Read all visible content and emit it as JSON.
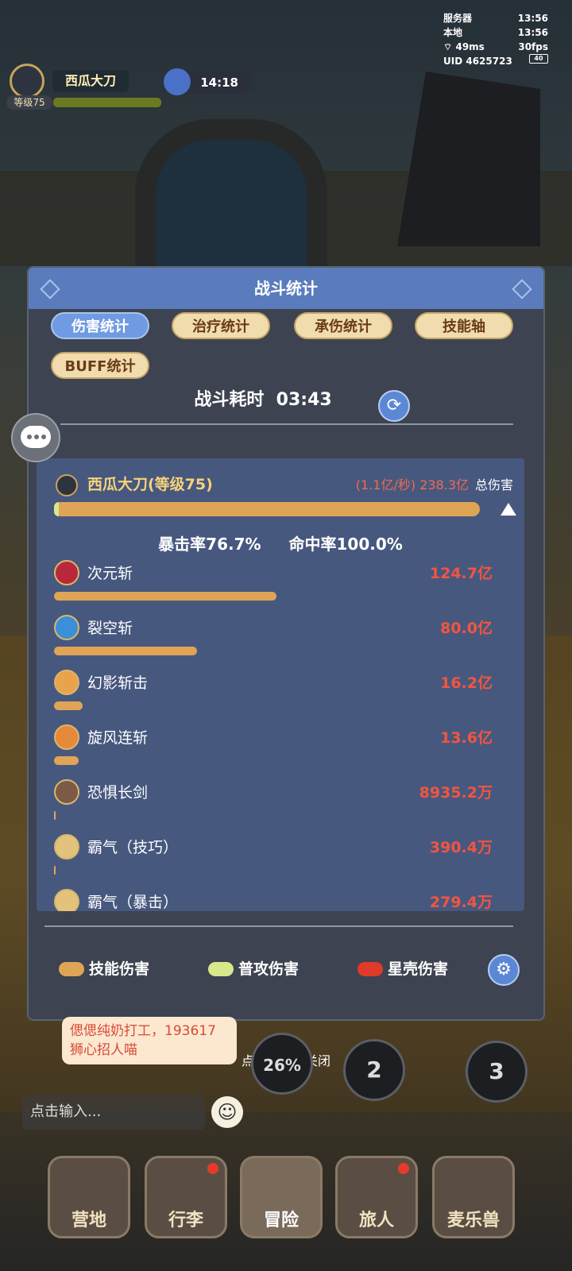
{
  "status": {
    "server_label": "服务器",
    "server_time": "13:56",
    "local_label": "本地",
    "local_time": "13:56",
    "ping": "49ms",
    "fps": "30fps",
    "uid": "UID 4625723",
    "battery": "40"
  },
  "player": {
    "name": "西瓜大刀",
    "level_badge": "等级75",
    "timer": "14:18"
  },
  "dialog": {
    "title": "战斗统计",
    "tabs": [
      "伤害统计",
      "治疗统计",
      "承伤统计",
      "技能轴",
      "BUFF统计"
    ],
    "active_tab": "伤害统计",
    "duration_label": "战斗耗时",
    "duration": "03:43",
    "character": {
      "name": "西瓜大刀(等级75)",
      "rate": "(1.1亿/秒)",
      "total": "238.3亿",
      "total_label": "总伤害",
      "crit": "暴击率76.7%",
      "hit": "命中率100.0%"
    },
    "skills": [
      {
        "name": "次元斩",
        "value": "124.7亿",
        "share": 0.523,
        "icon": "slash-red-icon"
      },
      {
        "name": "裂空斩",
        "value": "80.0亿",
        "share": 0.336,
        "icon": "rift-blue-icon"
      },
      {
        "name": "幻影斩击",
        "value": "16.2亿",
        "share": 0.068,
        "icon": "phantom-icon"
      },
      {
        "name": "旋风连斩",
        "value": "13.6亿",
        "share": 0.057,
        "icon": "whirlwind-icon"
      },
      {
        "name": "恐惧长剑",
        "value": "8935.2万",
        "share": 0.004,
        "icon": "sword-icon"
      },
      {
        "name": "霸气（技巧）",
        "value": "390.4万",
        "share": 0,
        "icon": "aura-icon"
      },
      {
        "name": "霸气（暴击）",
        "value": "279.4万",
        "share": 0,
        "icon": "aura-icon"
      }
    ],
    "legend": [
      {
        "label": "技能伤害",
        "color": "#e0a456"
      },
      {
        "label": "普攻伤害",
        "color": "#d8e88a"
      },
      {
        "label": "星壳伤害",
        "color": "#e03a2a"
      }
    ]
  },
  "chat": {
    "message": "偲偲纯奶打工，193617狮心招人喵",
    "input_placeholder": "点击输入...",
    "close_hint": "点击空白处关闭"
  },
  "skill_buttons": {
    "cooldown": "26%",
    "slot2": "2",
    "slot3": "3"
  },
  "nav": [
    {
      "label": "营地",
      "badge": false
    },
    {
      "label": "行李",
      "badge": true
    },
    {
      "label": "冒险",
      "badge": false,
      "active": true
    },
    {
      "label": "旅人",
      "badge": true
    },
    {
      "label": "麦乐兽",
      "badge": false
    }
  ]
}
